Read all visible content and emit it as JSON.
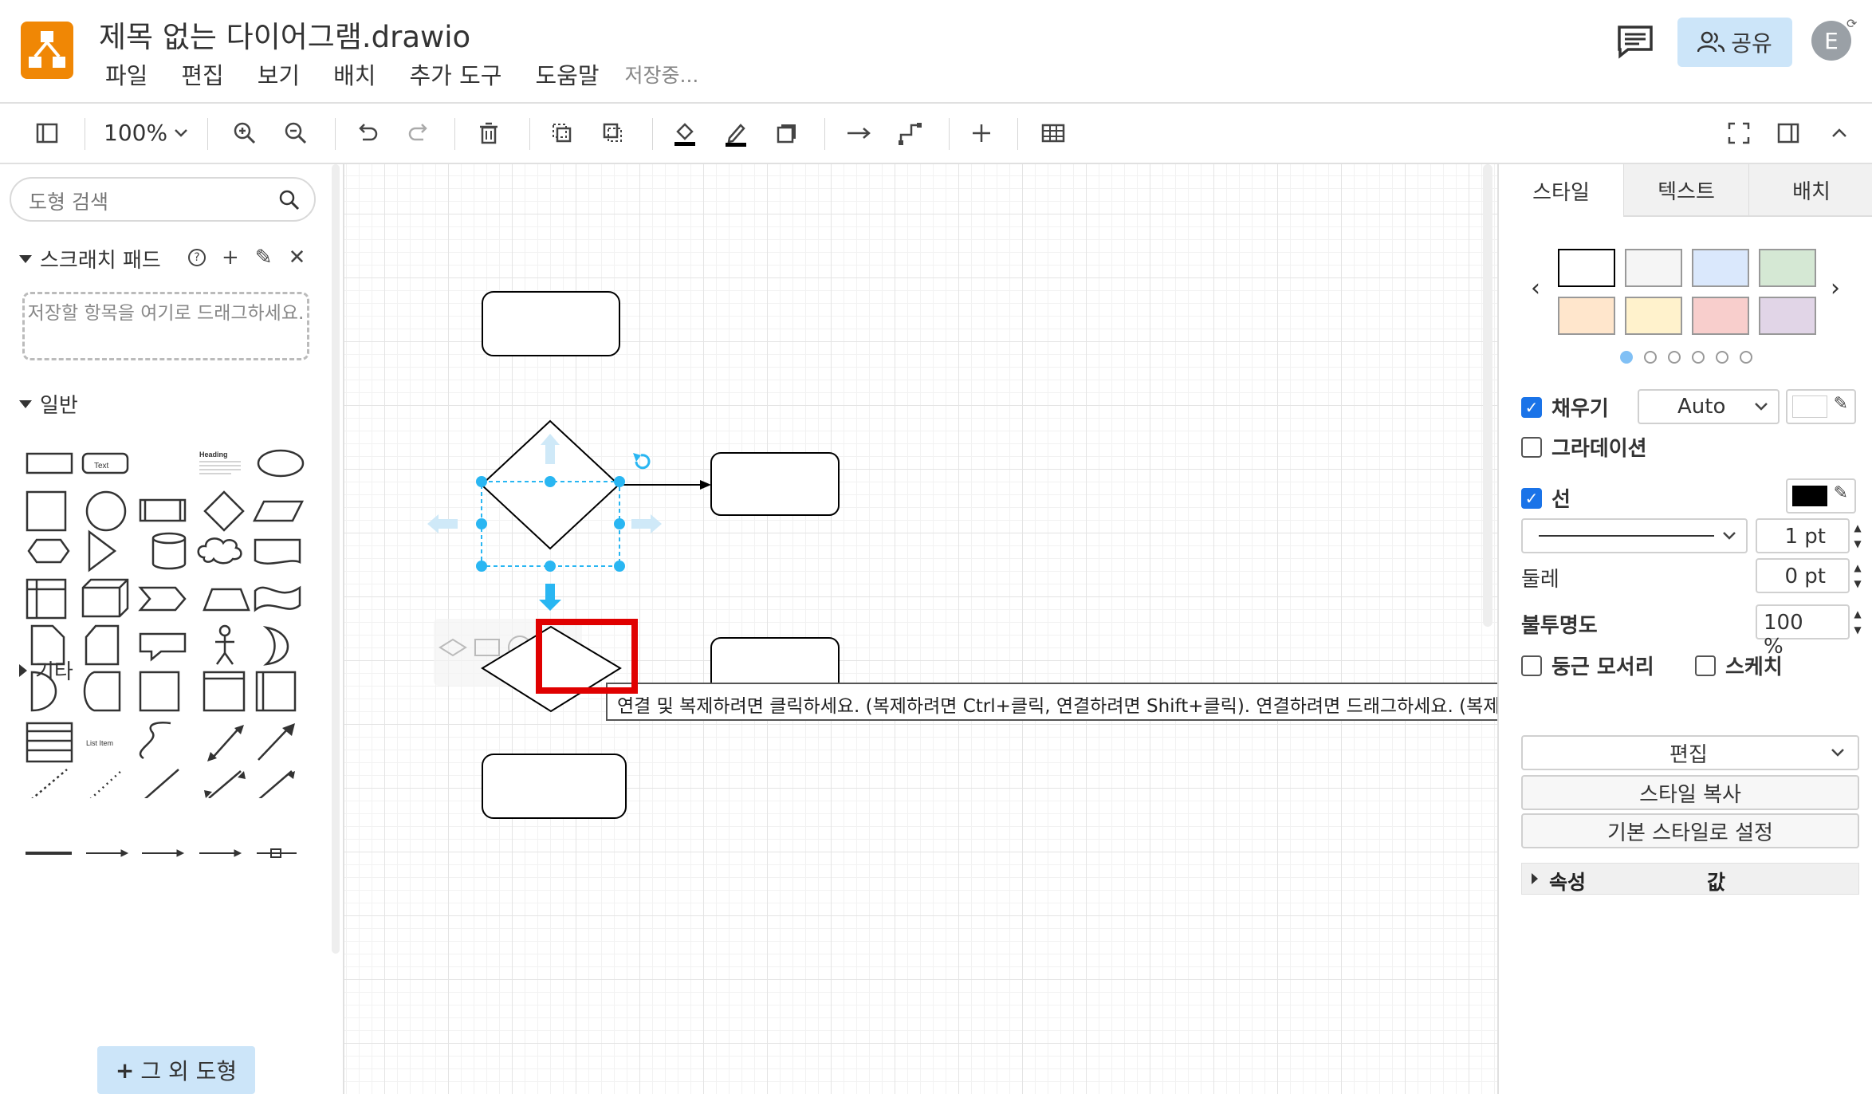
{
  "header": {
    "title": "제목 없는 다이어그램.drawio",
    "menu": [
      "파일",
      "편집",
      "보기",
      "배치",
      "추가 도구",
      "도움말"
    ],
    "save_status": "저장중...",
    "share_label": "공유",
    "avatar_initial": "E"
  },
  "toolbar": {
    "zoom": "100%"
  },
  "sidebar": {
    "search_placeholder": "도형 검색",
    "scratchpad_title": "스크래치 패드",
    "scratchpad_drop_text": "저장할 항목을 여기로 드래그하세요.",
    "general_title": "일반",
    "shape_text_label": "Text",
    "shape_heading_label": "Heading",
    "shape_list_item_label": "List Item",
    "other_title": "기타",
    "more_shapes_label": "그 외 도형"
  },
  "canvas": {
    "tooltip": "연결 및 복제하려면 클릭하세요. (복제하려면 Ctrl+클릭, 연결하려면 Shift+클릭). 연결하려면 드래그하세요. (복제하려면 Ctrl+드래그)."
  },
  "panel": {
    "tabs": [
      "스타일",
      "텍스트",
      "배치"
    ],
    "swatch_colors": [
      "#ffffff",
      "#f5f5f5",
      "#dae8fc",
      "#d5e8d4",
      "#ffe6cc",
      "#fff2cc",
      "#f8cecc",
      "#e1d5e7"
    ],
    "fill_label": "채우기",
    "fill_mode": "Auto",
    "gradient_label": "그라데이션",
    "line_label": "선",
    "line_width": "1 pt",
    "perimeter_label": "둘레",
    "perimeter_value": "0 pt",
    "opacity_label": "불투명도",
    "opacity_value": "100 %",
    "rounded_label": "둥근 모서리",
    "sketch_label": "스케치",
    "edit_label": "편집",
    "copy_style_label": "스타일 복사",
    "default_style_label": "기본 스타일로 설정",
    "prop_col": "속성",
    "value_col": "값"
  },
  "colors": {
    "brand": "#f08705",
    "selection": "#29b6f2",
    "share_bg": "#cce5f9",
    "highlight": "#e00000"
  }
}
